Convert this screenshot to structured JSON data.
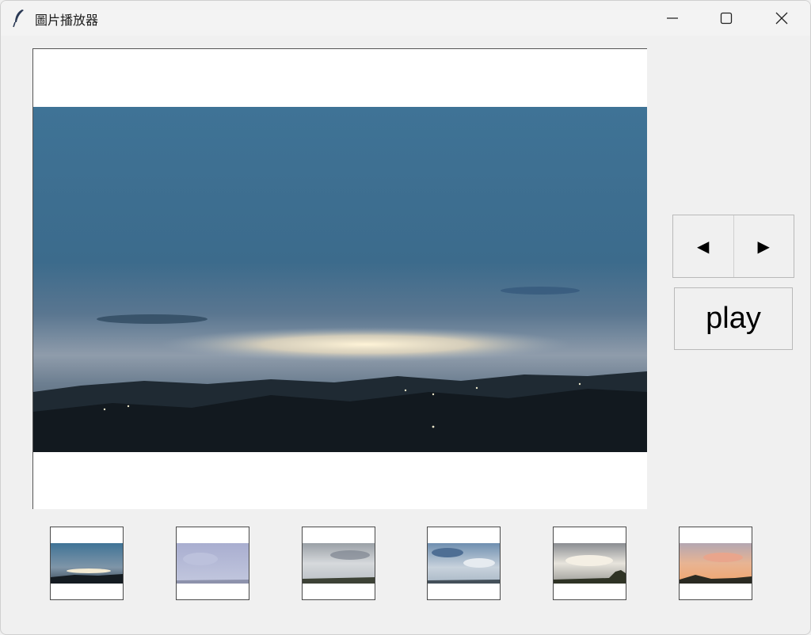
{
  "window": {
    "title": "圖片播放器",
    "controls": [
      "minimize-icon",
      "maximize-icon",
      "close-icon"
    ]
  },
  "viewer": {
    "current_index": 1
  },
  "controls": {
    "prev_label": "◀",
    "next_label": "▶",
    "play_label": "play"
  },
  "thumbnails": [
    {
      "index": 1,
      "scene": "dusk-sky-blue"
    },
    {
      "index": 2,
      "scene": "overcast-lavender"
    },
    {
      "index": 3,
      "scene": "cloudy-gray"
    },
    {
      "index": 4,
      "scene": "blue-clouds"
    },
    {
      "index": 5,
      "scene": "bright-clouds-trees"
    },
    {
      "index": 6,
      "scene": "sunset-orange"
    }
  ],
  "colors": {
    "background": "#f0f0f0",
    "viewer_bg": "#ffffff"
  }
}
